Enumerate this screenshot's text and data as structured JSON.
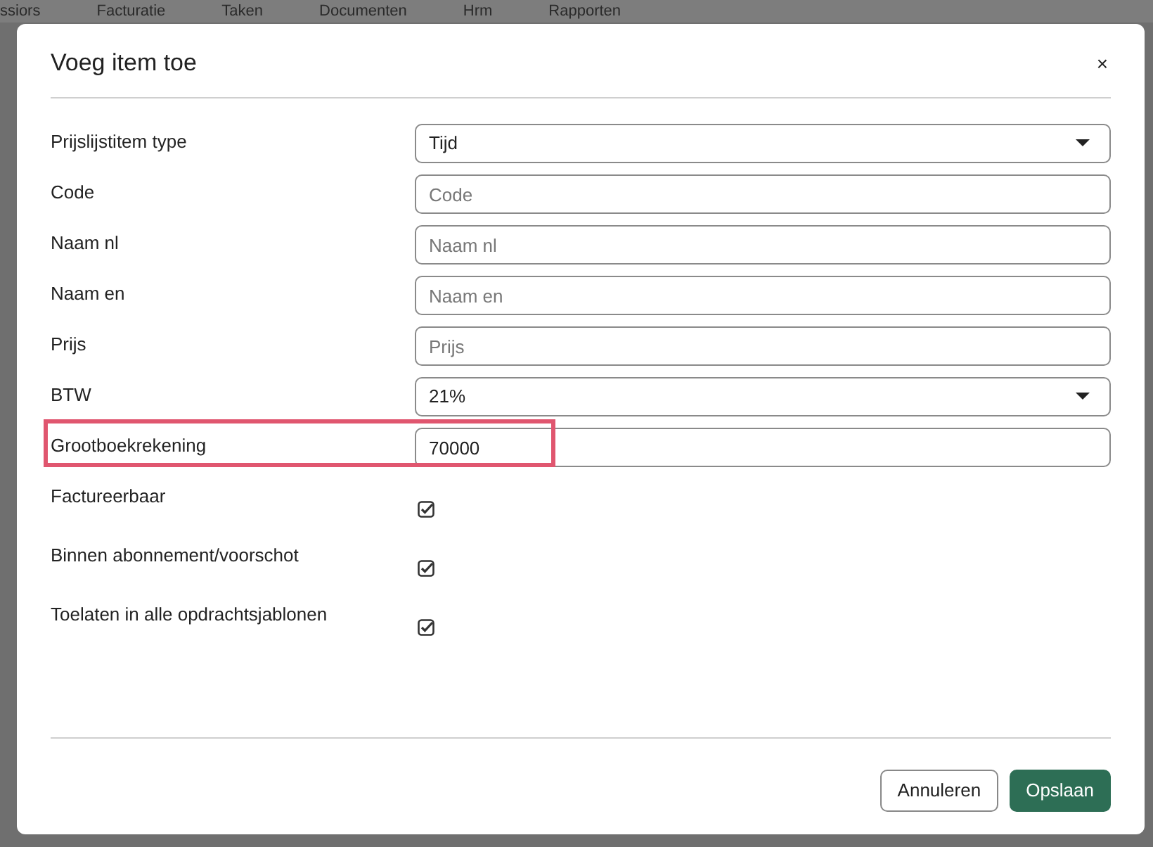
{
  "background_nav": [
    "ssiors",
    "Facturatie",
    "Taken",
    "Documenten",
    "Hrm",
    "Rapporten"
  ],
  "dialog": {
    "title": "Voeg item toe",
    "close": "×",
    "fields": [
      {
        "kind": "select",
        "label": "Prijslijstitem type",
        "value": "Tijd",
        "highlighted": false
      },
      {
        "kind": "input",
        "label": "Code",
        "placeholder": "Code",
        "highlighted": false
      },
      {
        "kind": "input",
        "label": "Naam nl",
        "placeholder": "Naam nl",
        "highlighted": false
      },
      {
        "kind": "input",
        "label": "Naam en",
        "placeholder": "Naam en",
        "highlighted": false
      },
      {
        "kind": "input",
        "label": "Prijs",
        "placeholder": "Prijs",
        "highlighted": false
      },
      {
        "kind": "select",
        "label": "BTW",
        "value": "21%",
        "highlighted": false
      },
      {
        "kind": "input",
        "label": "Grootboekrekening",
        "value": "70000",
        "highlighted": true
      },
      {
        "kind": "checkbox",
        "label": "Factureerbaar",
        "checked": true,
        "highlighted": false
      },
      {
        "kind": "checkbox",
        "label": "Binnen abonnement/voorschot",
        "checked": true,
        "highlighted": false
      },
      {
        "kind": "checkbox",
        "label": "Toelaten in alle opdrachtsjablonen",
        "checked": true,
        "highlighted": false
      }
    ],
    "buttons": [
      {
        "kind": "secondary",
        "label": "Annuleren"
      },
      {
        "kind": "primary",
        "label": "Opslaan"
      }
    ]
  }
}
